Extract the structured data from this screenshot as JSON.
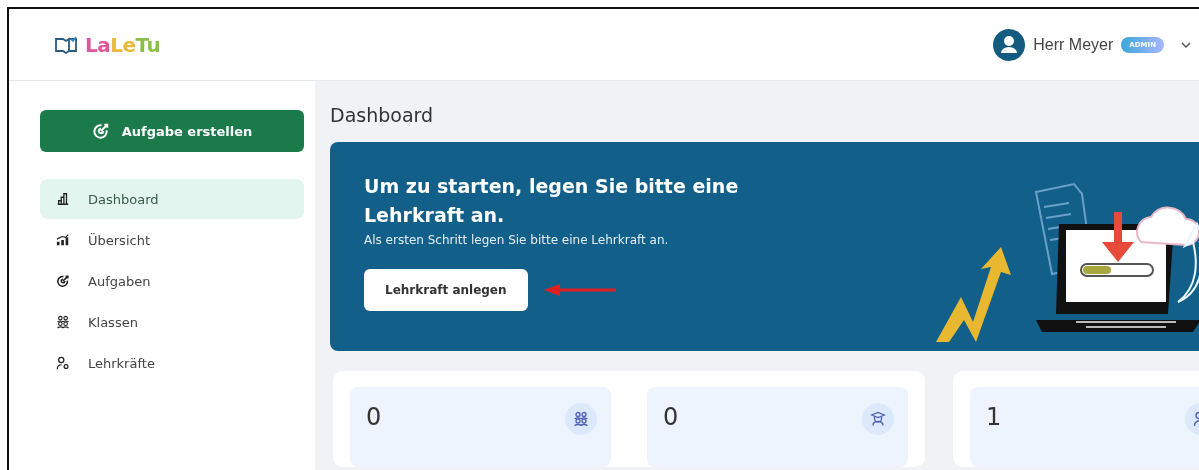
{
  "header": {
    "logo": {
      "letters": [
        {
          "text": "La",
          "color": "#e0569a"
        },
        {
          "text": "Le",
          "color": "#e8b93a"
        },
        {
          "text": "Tu",
          "color": "#8cbf4a"
        }
      ]
    },
    "user": {
      "name": "Herr Meyer",
      "badge": "ADMIN"
    }
  },
  "sidebar": {
    "create_button": "Aufgabe erstellen",
    "items": [
      {
        "label": "Dashboard",
        "kind": "bars",
        "selected": true
      },
      {
        "label": "Übersicht",
        "kind": "rising",
        "selected": false
      },
      {
        "label": "Aufgaben",
        "kind": "target",
        "selected": false
      },
      {
        "label": "Klassen",
        "kind": "group",
        "selected": false
      },
      {
        "label": "Lehrkräfte",
        "kind": "teacher",
        "selected": false
      }
    ]
  },
  "main": {
    "title": "Dashboard",
    "banner": {
      "heading": "Um zu starten, legen Sie bitte eine Lehrkraft an.",
      "text": "Als ersten Schritt legen Sie bitte eine Lehrkraft an.",
      "button": "Lehrkraft anlegen"
    },
    "stat_groups": [
      {
        "stats": [
          {
            "value": "0",
            "kind": "group"
          },
          {
            "value": "0",
            "kind": "graduate"
          }
        ]
      },
      {
        "stats": [
          {
            "value": "1",
            "kind": "teacher"
          }
        ]
      }
    ]
  }
}
